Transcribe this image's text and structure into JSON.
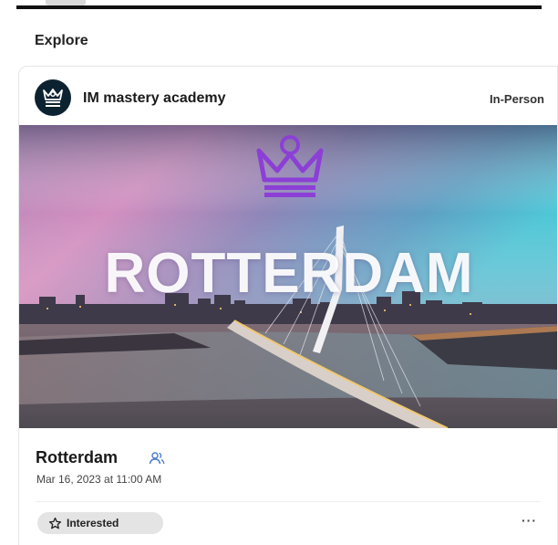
{
  "page": {
    "section_title": "Explore"
  },
  "card": {
    "organizer": "IM mastery academy",
    "event_type": "In-Person",
    "banner_text": "ROTTERDAM",
    "event_title": "Rotterdam",
    "event_date": "Mar 16, 2023 at 11:00 AM",
    "interested_label": "Interested",
    "more_label": "···",
    "icons": {
      "avatar": "crown-logo-icon",
      "banner_logo": "crown-logo-icon",
      "attendees": "people-icon",
      "interested": "star-icon",
      "more": "more-icon"
    }
  },
  "colors": {
    "accent_purple": "#8c3fd6",
    "avatar_bg": "#0d2230",
    "attendees_icon": "#4a7bd0",
    "button_bg": "#e4e4e4"
  }
}
